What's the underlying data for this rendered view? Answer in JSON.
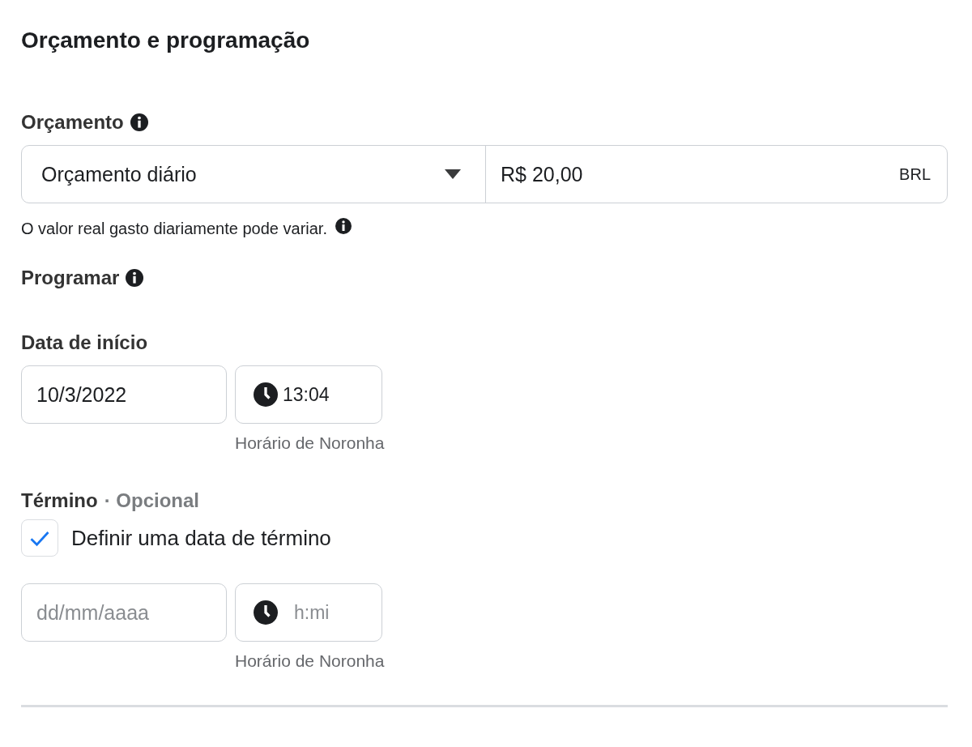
{
  "title": "Orçamento e programação",
  "budget": {
    "label": "Orçamento",
    "type_dropdown": {
      "value": "Orçamento diário"
    },
    "amount": {
      "value": "R$ 20,00",
      "currency": "BRL"
    },
    "help": "O valor real gasto diariamente pode variar."
  },
  "schedule": {
    "label": "Programar"
  },
  "start": {
    "label": "Data de início",
    "date": {
      "value": "10/3/2022"
    },
    "time": {
      "value": "13:04"
    },
    "timezone": "Horário de Noronha"
  },
  "end": {
    "label": "Término",
    "optional": "· Opcional",
    "checkbox": {
      "label": "Definir uma data de término",
      "checked": true
    },
    "date": {
      "placeholder": "dd/mm/aaaa"
    },
    "time": {
      "placeholder": "h:mi"
    },
    "timezone": "Horário de Noronha"
  }
}
